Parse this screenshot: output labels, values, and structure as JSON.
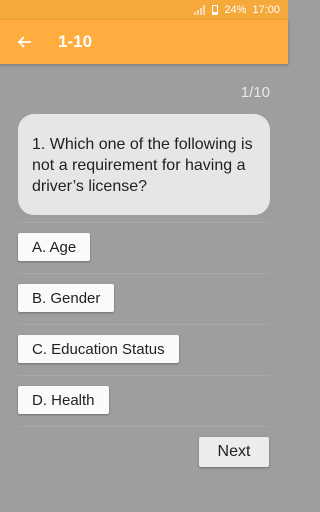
{
  "status_bar": {
    "battery": "24%",
    "time": "17:00"
  },
  "app_bar": {
    "title": "1-10"
  },
  "quiz": {
    "progress": "1/10",
    "question": "1. Which one of the following is not a requirement for having a driver’s license?",
    "options": [
      "A. Age",
      "B. Gender",
      "C. Education Status",
      "D. Health"
    ],
    "next_label": "Next"
  },
  "colors": {
    "accent": "#ffad3f",
    "background": "#9e9e9e",
    "bubble": "#e6e6e6"
  }
}
